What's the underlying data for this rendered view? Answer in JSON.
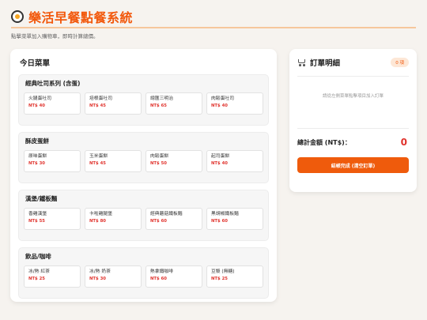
{
  "header": {
    "logo_icon": "frying-pan-egg-icon",
    "title": "樂活早餐點餐系統",
    "subtitle": "點擊菜單加入購物車，即時計算總價。",
    "accent_color": "#f2580c"
  },
  "menu": {
    "title": "今日菜單",
    "categories": [
      {
        "name": "經典吐司系列 (含蛋)",
        "items": [
          {
            "name": "火腿蛋吐司",
            "price": "NT$ 40"
          },
          {
            "name": "培根蛋吐司",
            "price": "NT$ 45"
          },
          {
            "name": "總匯三明治",
            "price": "NT$ 65"
          },
          {
            "name": "肉鬆蛋吐司",
            "price": "NT$ 40"
          }
        ]
      },
      {
        "name": "酥皮蛋餅",
        "items": [
          {
            "name": "原味蛋餅",
            "price": "NT$ 30"
          },
          {
            "name": "玉米蛋餅",
            "price": "NT$ 45"
          },
          {
            "name": "肉鬆蛋餅",
            "price": "NT$ 50"
          },
          {
            "name": "起司蛋餅",
            "price": "NT$ 40"
          }
        ]
      },
      {
        "name": "漢堡/鐵板麵",
        "items": [
          {
            "name": "香雞漢堡",
            "price": "NT$ 55"
          },
          {
            "name": "卡啦雞腿堡",
            "price": "NT$ 80"
          },
          {
            "name": "經典蘑菇鐵板麵",
            "price": "NT$ 60"
          },
          {
            "name": "黑胡椒鐵板麵",
            "price": "NT$ 60"
          }
        ]
      },
      {
        "name": "飲品/咖啡",
        "items": [
          {
            "name": "冰/熱 紅茶",
            "price": "NT$ 25"
          },
          {
            "name": "冰/熱 奶茶",
            "price": "NT$ 30"
          },
          {
            "name": "熱拿鐵咖啡",
            "price": "NT$ 60"
          },
          {
            "name": "豆漿 (無糖)",
            "price": "NT$ 25"
          }
        ]
      }
    ]
  },
  "order": {
    "icon": "cart-icon",
    "title": "訂單明細",
    "count": "0 項",
    "empty_text": "請從左側菜單點擊項目加入訂單",
    "total_label": "總計金額 (NT$)：",
    "total_value": "0",
    "checkout_label": "結帳完成 (清空訂單)"
  }
}
